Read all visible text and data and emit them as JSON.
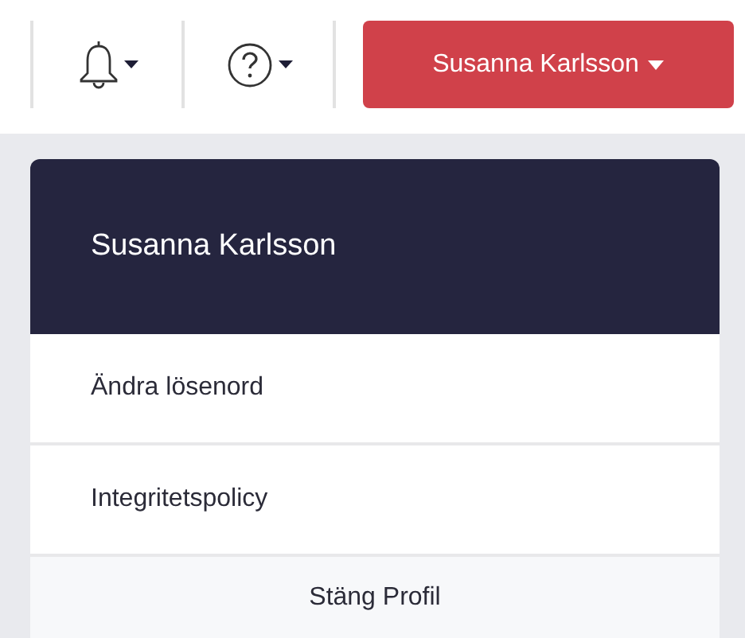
{
  "toolbar": {
    "user_button": {
      "label": "Susanna Karlsson"
    }
  },
  "profile_menu": {
    "header": "Susanna Karlsson",
    "items": [
      {
        "label": "Ändra lösenord"
      },
      {
        "label": "Integritetspolicy"
      }
    ],
    "footer": "Stäng Profil"
  }
}
